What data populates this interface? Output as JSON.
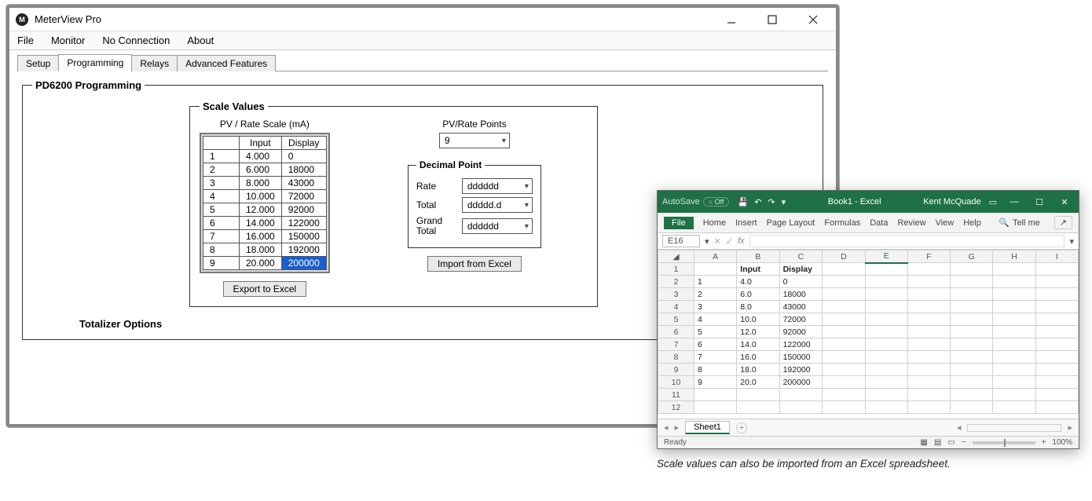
{
  "mvp": {
    "title": "MeterView Pro",
    "menu": [
      "File",
      "Monitor",
      "No Connection",
      "About"
    ],
    "tabs": [
      "Setup",
      "Programming",
      "Relays",
      "Advanced Features"
    ],
    "active_tab": 1,
    "group_title": "PD6200 Programming",
    "scale": {
      "title": "Scale Values",
      "table_caption": "PV / Rate Scale (mA)",
      "cols": [
        "",
        "Input",
        "Display"
      ],
      "rows": [
        {
          "n": "1",
          "input": "4.000",
          "display": "0"
        },
        {
          "n": "2",
          "input": "6.000",
          "display": "18000"
        },
        {
          "n": "3",
          "input": "8.000",
          "display": "43000"
        },
        {
          "n": "4",
          "input": "10.000",
          "display": "72000"
        },
        {
          "n": "5",
          "input": "12.000",
          "display": "92000"
        },
        {
          "n": "6",
          "input": "14.000",
          "display": "122000"
        },
        {
          "n": "7",
          "input": "16.000",
          "display": "150000"
        },
        {
          "n": "8",
          "input": "18.000",
          "display": "192000"
        },
        {
          "n": "9",
          "input": "20.000",
          "display": "200000"
        }
      ],
      "selected_row": 8,
      "export_btn": "Export to Excel",
      "import_btn": "Import from Excel",
      "pvpoints_label": "PV/Rate Points",
      "pvpoints_value": "9",
      "dec_point_label": "Decimal Point",
      "dp": {
        "rate_label": "Rate",
        "rate_value": "dddddd",
        "total_label": "Total",
        "total_value": "ddddd.d",
        "grand_label": "Grand Total",
        "grand_value": "dddddd"
      }
    },
    "totalizer_title": "Totalizer Options"
  },
  "excel": {
    "autosave_label": "AutoSave",
    "title": "Book1 - Excel",
    "user": "Kent McQuade",
    "ribbon": [
      "Home",
      "Insert",
      "Page Layout",
      "Formulas",
      "Data",
      "Review",
      "View",
      "Help"
    ],
    "file": "File",
    "tellme": "Tell me",
    "namebox": "E16",
    "cols": [
      "A",
      "B",
      "C",
      "D",
      "E",
      "F",
      "G",
      "H",
      "I"
    ],
    "selected_col": "E",
    "rows": [
      {
        "r": "1",
        "a": "",
        "b": "Input",
        "c": "Display"
      },
      {
        "r": "2",
        "a": "1",
        "b": "4.0",
        "c": "0"
      },
      {
        "r": "3",
        "a": "2",
        "b": "6.0",
        "c": "18000"
      },
      {
        "r": "4",
        "a": "3",
        "b": "8.0",
        "c": "43000"
      },
      {
        "r": "5",
        "a": "4",
        "b": "10.0",
        "c": "72000"
      },
      {
        "r": "6",
        "a": "5",
        "b": "12.0",
        "c": "92000"
      },
      {
        "r": "7",
        "a": "6",
        "b": "14.0",
        "c": "122000"
      },
      {
        "r": "8",
        "a": "7",
        "b": "16.0",
        "c": "150000"
      },
      {
        "r": "9",
        "a": "8",
        "b": "18.0",
        "c": "192000"
      },
      {
        "r": "10",
        "a": "9",
        "b": "20.0",
        "c": "200000"
      },
      {
        "r": "11",
        "a": "",
        "b": "",
        "c": ""
      },
      {
        "r": "12",
        "a": "",
        "b": "",
        "c": ""
      }
    ],
    "sheet": "Sheet1",
    "status": "Ready",
    "zoom": "100%"
  },
  "caption": "Scale values can also be imported from an Excel spreadsheet."
}
